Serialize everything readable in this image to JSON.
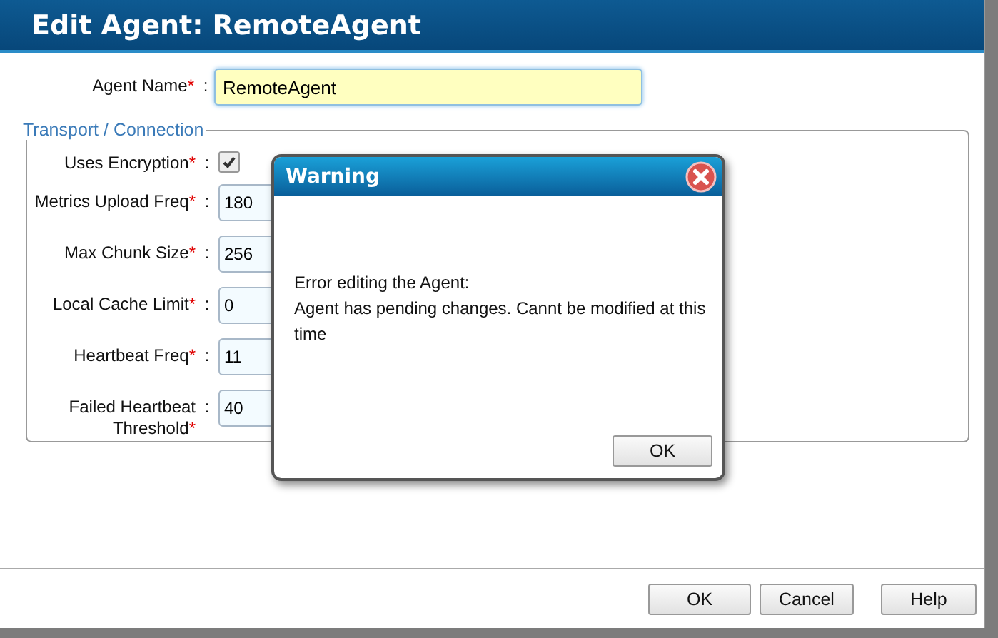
{
  "window": {
    "title": "Edit Agent: RemoteAgent"
  },
  "agent_name": {
    "label": "Agent Name",
    "required_mark": "*",
    "separator": ":",
    "value": "RemoteAgent",
    "focused": true
  },
  "transport": {
    "legend": "Transport / Connection",
    "fields": [
      {
        "kind": "checkbox",
        "label": "Uses Encryption",
        "required_mark": "*",
        "separator": ":",
        "checked": true
      },
      {
        "kind": "text",
        "label": "Metrics Upload Freq",
        "required_mark": "*",
        "separator": ":",
        "value": "180"
      },
      {
        "kind": "text",
        "label": "Max Chunk Size",
        "required_mark": "*",
        "separator": ":",
        "value": "256"
      },
      {
        "kind": "text",
        "label": "Local Cache Limit",
        "required_mark": "*",
        "separator": ":",
        "value": "0"
      },
      {
        "kind": "text",
        "label": "Heartbeat Freq",
        "required_mark": "*",
        "separator": ":",
        "value": "11"
      },
      {
        "kind": "text",
        "label": "Failed Heartbeat Threshold",
        "required_mark": "*",
        "separator": ":",
        "value": "40"
      }
    ]
  },
  "warning": {
    "title": "Warning",
    "message_lines": [
      "Error editing the Agent:",
      "Agent has pending changes. Cannt be modified at this time"
    ],
    "button": "OK"
  },
  "buttons": [
    "OK",
    "Cancel",
    "Help"
  ]
}
